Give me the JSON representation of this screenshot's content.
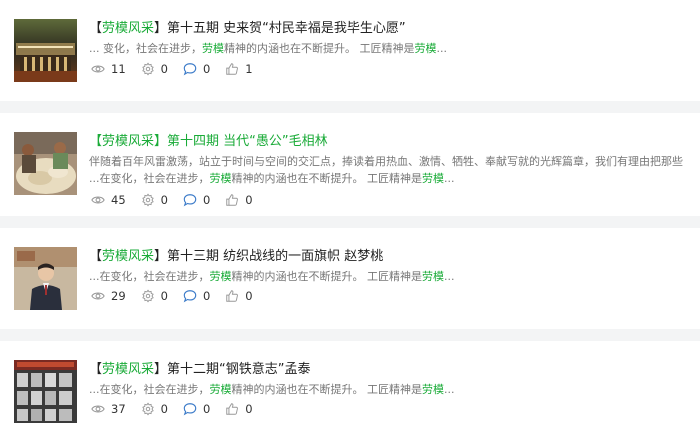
{
  "articles": [
    {
      "tag": "劳模风采",
      "title": "第十五期 史来贺“村民幸福是我毕生心愿”",
      "summary_lines": [
        {
          "before": "... 变化，社会在进步，",
          "highlight": "劳模",
          "middle": "精神的内涵也在不断提升。 工匠精神是",
          "highlight2": "劳模",
          "after": "..."
        }
      ],
      "stats": {
        "views": "11",
        "shares": "0",
        "comments": "0",
        "likes": "1"
      }
    },
    {
      "tag": "劳模风采",
      "title": "第十四期  当代“愚公”毛相林",
      "summary_lines": [
        {
          "before": "伴随着百年风雷激荡，站立于时间与空间的交汇点，捧读着用热血、激情、牺牲、奉献写就的光辉篇章，我们有理由把那些",
          "highlight": "",
          "middle": "",
          "highlight2": "",
          "after": ""
        },
        {
          "before": "...在变化，社会在进步，",
          "highlight": "劳模",
          "middle": "精神的内涵也在不断提升。 工匠精神是",
          "highlight2": "劳模",
          "after": "..."
        }
      ],
      "stats": {
        "views": "45",
        "shares": "0",
        "comments": "0",
        "likes": "0"
      }
    },
    {
      "tag": "劳模风采",
      "title": "第十三期 纺织战线的一面旗帜 赵梦桃",
      "summary_lines": [
        {
          "before": "...在变化，社会在进步，",
          "highlight": "劳模",
          "middle": "精神的内涵也在不断提升。 工匠精神是",
          "highlight2": "劳模",
          "after": "..."
        }
      ],
      "stats": {
        "views": "29",
        "shares": "0",
        "comments": "0",
        "likes": "0"
      }
    },
    {
      "tag": "劳模风采",
      "title": "第十二期“钢铁意志”孟泰",
      "summary_lines": [
        {
          "before": "...在变化，社会在进步，",
          "highlight": "劳模",
          "middle": "精神的内涵也在不断提升。 工匠精神是",
          "highlight2": "劳模",
          "after": "..."
        }
      ],
      "stats": {
        "views": "37",
        "shares": "0",
        "comments": "0",
        "likes": "0"
      }
    }
  ],
  "icons": {
    "views": "eye-icon",
    "shares": "share-gear-icon",
    "comments": "comment-bubble-icon",
    "likes": "thumbs-up-icon"
  },
  "colors": {
    "accent_green": "#1aab38",
    "text": "#222222",
    "muted": "#777777",
    "icon_blue": "#3d7cc9",
    "icon_gray": "#999999",
    "background": "#f3f4f5"
  }
}
